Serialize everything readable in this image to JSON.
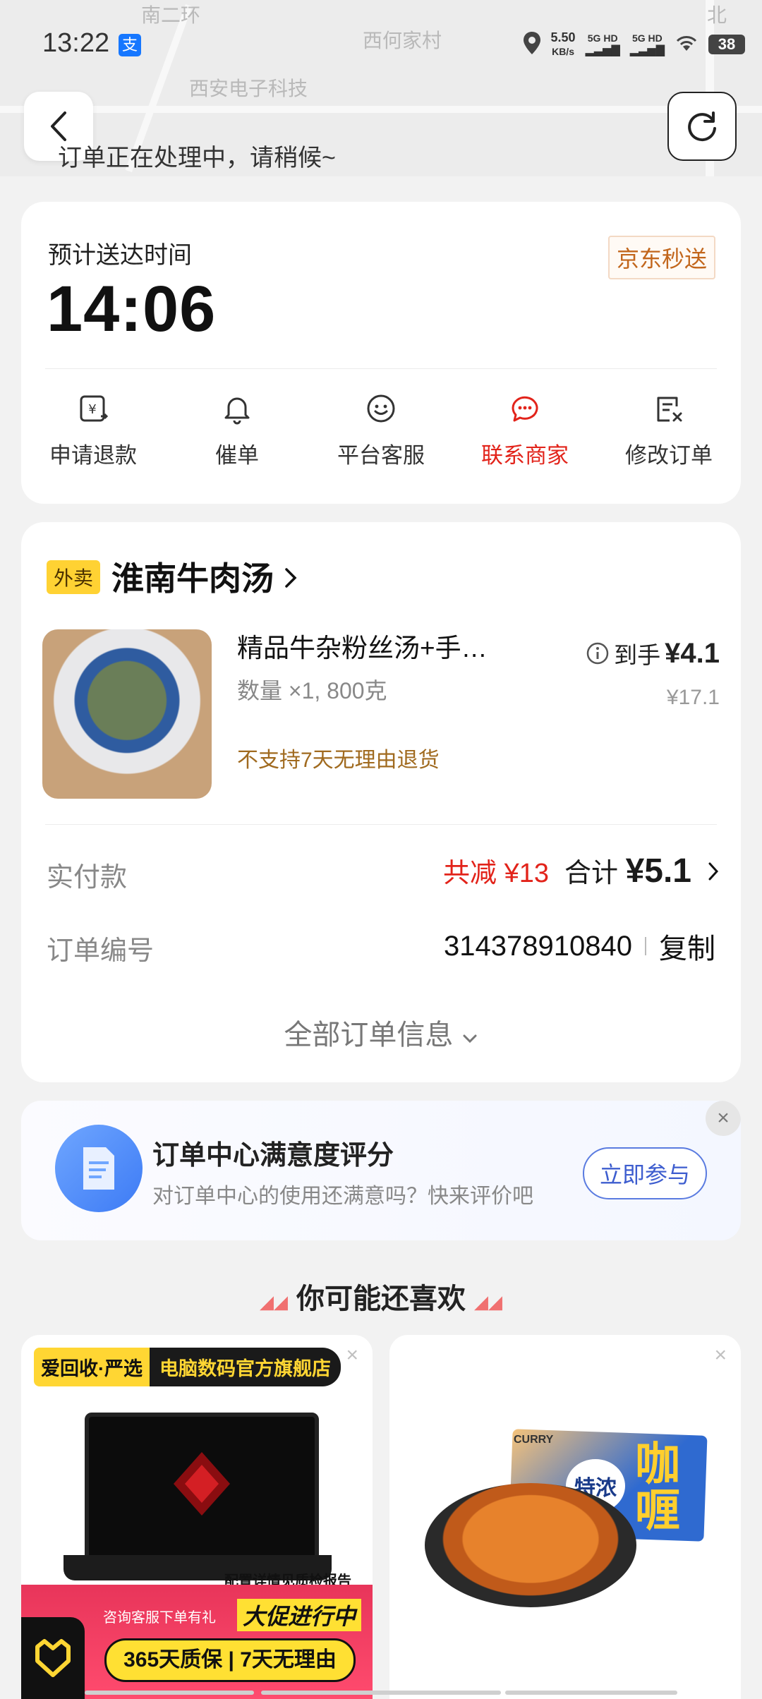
{
  "status_bar": {
    "time": "13:22",
    "alipay_glyph": "支",
    "speed_value": "5.50",
    "speed_unit": "KB/s",
    "sim1": "5G HD",
    "sim2": "5G HD",
    "battery": "38"
  },
  "map": {
    "labels": [
      "南二环",
      "西何家村",
      "西安电子科技",
      "北"
    ]
  },
  "header": {
    "processing_text": "订单正在处理中，请稍候~"
  },
  "eta": {
    "label": "预计送达时间",
    "time": "14:06",
    "service_tag": "京东秒送"
  },
  "actions": [
    {
      "label": "申请退款",
      "icon": "refund-icon"
    },
    {
      "label": "催单",
      "icon": "bell-icon"
    },
    {
      "label": "平台客服",
      "icon": "smiley-service-icon"
    },
    {
      "label": "联系商家",
      "icon": "chat-merchant-icon",
      "active": true
    },
    {
      "label": "修改订单",
      "icon": "edit-order-icon"
    }
  ],
  "order": {
    "type_tag": "外卖",
    "shop_name": "淮南牛肉汤",
    "item_name": "精品牛杂粉丝汤+手…",
    "quantity": "数量 ×1, 800克",
    "return_policy": "不支持7天无理由退货",
    "net_label": "到手",
    "net_price": "¥4.1",
    "original_price": "¥17.1",
    "paid_label": "实付款",
    "discount": "共减 ¥13",
    "total_label": "合计",
    "total_amount": "¥5.1",
    "order_no_label": "订单编号",
    "order_no": "314378910840",
    "copy_label": "复制",
    "all_info_label": "全部订单信息"
  },
  "survey": {
    "title": "订单中心满意度评分",
    "subtitle": "对订单中心的使用还满意吗？快来评价吧",
    "button": "立即参与",
    "close": "×"
  },
  "recommend": {
    "title": "你可能还喜欢",
    "products": [
      {
        "badge_left": "爱回收·严选",
        "badge_right": "电脑数码官方旗舰店",
        "report": "配置详情见质检报告",
        "promo_small": "咨询客服下单有礼",
        "promo_big": "大促进行中",
        "guarantee": "365天质保 | 7天无理由",
        "close": "×"
      },
      {
        "box_brand": "CURRY",
        "box_special": "特浓",
        "box_text": "咖喱",
        "close": "×"
      }
    ]
  },
  "colors": {
    "accent_red": "#e2231a",
    "brand_orange": "#c2661c",
    "survey_blue": "#3d5dcf"
  }
}
